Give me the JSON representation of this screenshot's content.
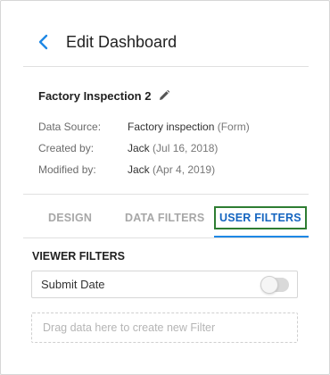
{
  "header": {
    "title": "Edit Dashboard",
    "back_icon": "chevron-left-icon"
  },
  "dashboard": {
    "name": "Factory Inspection 2",
    "edit_icon": "pencil-icon"
  },
  "meta": {
    "data_source_label": "Data Source:",
    "data_source_value": "Factory inspection",
    "data_source_type": "(Form)",
    "created_by_label": "Created by:",
    "created_by_name": "Jack",
    "created_by_date": "(Jul 16, 2018)",
    "modified_by_label": "Modified by:",
    "modified_by_name": "Jack",
    "modified_by_date": "(Apr 4, 2019)"
  },
  "tabs": [
    {
      "label": "DESIGN",
      "active": false
    },
    {
      "label": "DATA FILTERS",
      "active": false
    },
    {
      "label": "USER FILTERS",
      "active": true
    }
  ],
  "viewer_filters": {
    "title": "VIEWER FILTERS",
    "items": [
      {
        "label": "Submit Date",
        "enabled": false
      }
    ],
    "dropzone_placeholder": "Drag data here to create new Filter"
  },
  "colors": {
    "accent": "#1e88e5",
    "active_tab_text": "#1565c0",
    "highlight_border": "#2e7d32",
    "inactive_tab_text": "#a7a7a7"
  }
}
